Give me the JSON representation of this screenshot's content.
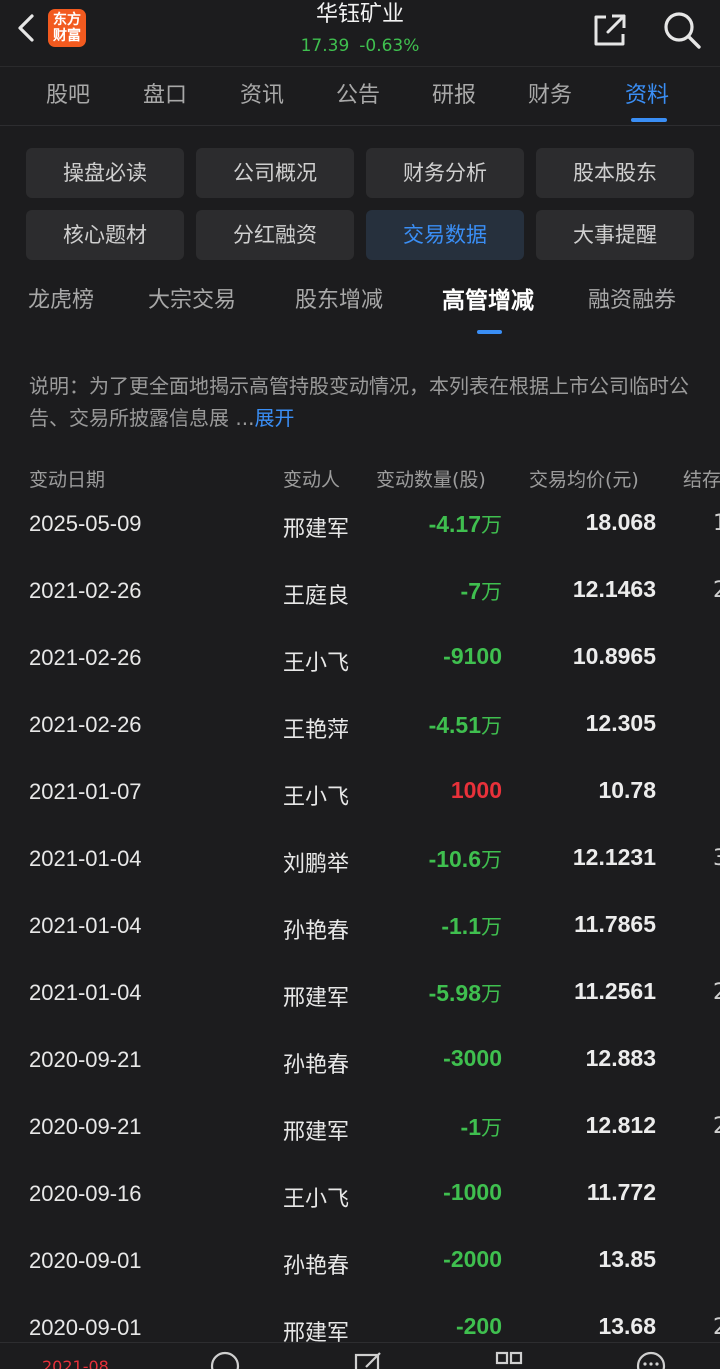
{
  "header": {
    "title": "华钰矿业",
    "price": "17.39",
    "change_pct": "-0.63%",
    "logo_line1": "东方",
    "logo_line2": "财富"
  },
  "tabs": [
    "股吧",
    "盘口",
    "资讯",
    "公告",
    "研报",
    "财务",
    "资料"
  ],
  "active_tab": "资料",
  "grid_buttons": [
    "操盘必读",
    "公司概况",
    "财务分析",
    "股本股东",
    "核心题材",
    "分红融资",
    "交易数据",
    "大事提醒"
  ],
  "active_grid_button": "交易数据",
  "subtabs": [
    "龙虎榜",
    "大宗交易",
    "股东增减",
    "高管增减",
    "融资融券"
  ],
  "active_subtab": "高管增减",
  "note": {
    "text": "说明：为了更全面地揭示高管持股变动情况，本列表在根据上市公司临时公告、交易所披露信息展 ...",
    "more_label": "展开"
  },
  "table": {
    "headers": [
      "变动日期",
      "变动人",
      "变动数量(股)",
      "交易均价(元)",
      "结存"
    ],
    "rows": [
      {
        "date": "2025-05-09",
        "person": "邢建军",
        "qty": "-4.17",
        "unit": "万",
        "avg": "18.068",
        "direction": "down",
        "last": "1"
      },
      {
        "date": "2021-02-26",
        "person": "王庭良",
        "qty": "-7",
        "unit": "万",
        "avg": "12.1463",
        "direction": "down",
        "last": "2"
      },
      {
        "date": "2021-02-26",
        "person": "王小飞",
        "qty": "-9100",
        "unit": "",
        "avg": "10.8965",
        "direction": "down",
        "last": ""
      },
      {
        "date": "2021-02-26",
        "person": "王艳萍",
        "qty": "-4.51",
        "unit": "万",
        "avg": "12.305",
        "direction": "down",
        "last": ""
      },
      {
        "date": "2021-01-07",
        "person": "王小飞",
        "qty": "1000",
        "unit": "",
        "avg": "10.78",
        "direction": "up",
        "last": ""
      },
      {
        "date": "2021-01-04",
        "person": "刘鹏举",
        "qty": "-10.6",
        "unit": "万",
        "avg": "12.1231",
        "direction": "down",
        "last": "3"
      },
      {
        "date": "2021-01-04",
        "person": "孙艳春",
        "qty": "-1.1",
        "unit": "万",
        "avg": "11.7865",
        "direction": "down",
        "last": ""
      },
      {
        "date": "2021-01-04",
        "person": "邢建军",
        "qty": "-5.98",
        "unit": "万",
        "avg": "11.2561",
        "direction": "down",
        "last": "2"
      },
      {
        "date": "2020-09-21",
        "person": "孙艳春",
        "qty": "-3000",
        "unit": "",
        "avg": "12.883",
        "direction": "down",
        "last": ""
      },
      {
        "date": "2020-09-21",
        "person": "邢建军",
        "qty": "-1",
        "unit": "万",
        "avg": "12.812",
        "direction": "down",
        "last": "2"
      },
      {
        "date": "2020-09-16",
        "person": "王小飞",
        "qty": "-1000",
        "unit": "",
        "avg": "11.772",
        "direction": "down",
        "last": ""
      },
      {
        "date": "2020-09-01",
        "person": "孙艳春",
        "qty": "-2000",
        "unit": "",
        "avg": "13.85",
        "direction": "down",
        "last": ""
      },
      {
        "date": "2020-09-01",
        "person": "邢建军",
        "qty": "-200",
        "unit": "",
        "avg": "13.68",
        "direction": "down",
        "last": "2"
      }
    ]
  },
  "bottom_bar": {
    "left_text": "2021-08"
  },
  "colors": {
    "background": "#1c1c1e",
    "accent": "#3a8ef5",
    "down": "#3fbf4f",
    "up": "#e8313a",
    "logo": "#f25a1f"
  }
}
